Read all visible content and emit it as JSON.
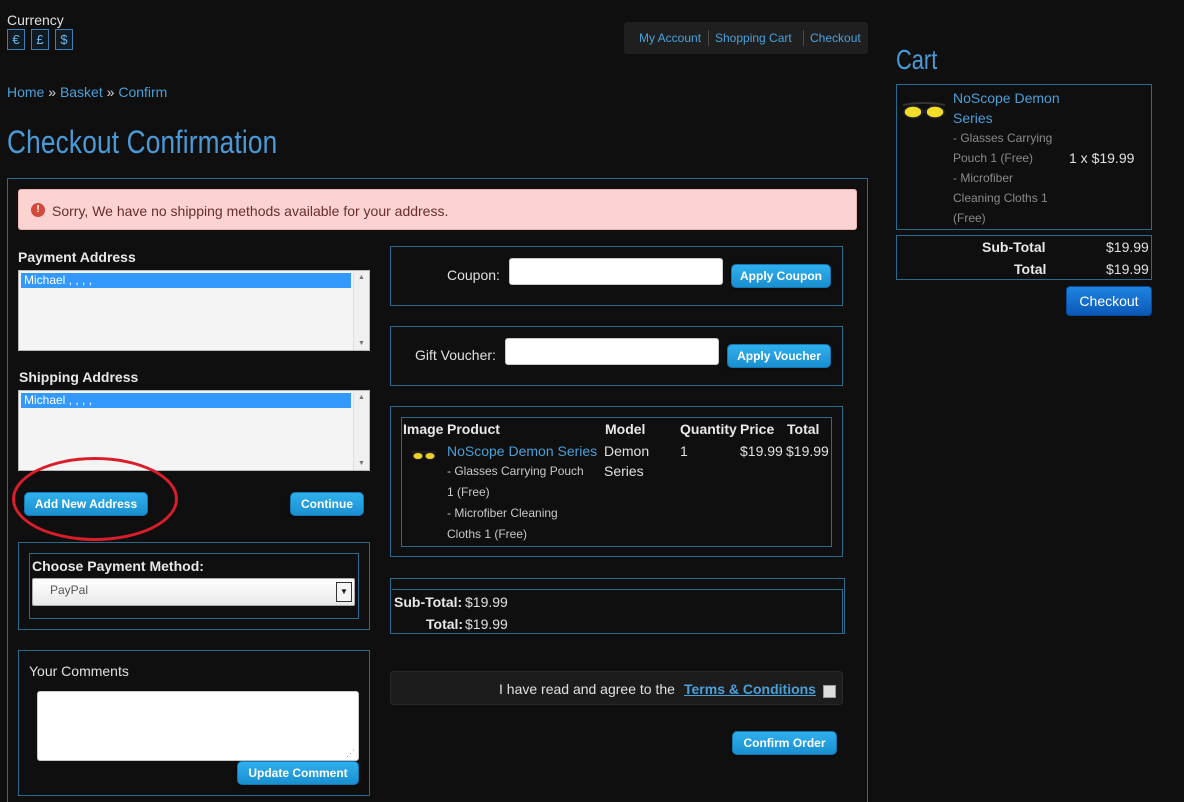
{
  "currency": {
    "label": "Currency",
    "symbols": [
      "€",
      "£",
      "$"
    ]
  },
  "top_nav": {
    "items": [
      "My Account",
      "Shopping Cart",
      "Checkout"
    ]
  },
  "breadcrumb": {
    "items": [
      "Home",
      "Basket",
      "Confirm"
    ],
    "separator": "»"
  },
  "page": {
    "title": "Checkout Confirmation"
  },
  "alert": {
    "icon": "!",
    "message": "Sorry, We have no shipping methods available for your address."
  },
  "payment_address": {
    "label": "Payment Address",
    "selected": "Michael , , , ,"
  },
  "shipping_address": {
    "label": "Shipping Address",
    "selected": "Michael , , , ,"
  },
  "buttons": {
    "add_new_address": "Add New Address",
    "continue": "Continue",
    "apply_coupon": "Apply Coupon",
    "apply_voucher": "Apply Voucher",
    "update_comment": "Update Comment",
    "confirm_order": "Confirm Order"
  },
  "payment_method": {
    "label": "Choose Payment Method:",
    "selected": "PayPal"
  },
  "comments": {
    "label": "Your Comments",
    "value": ""
  },
  "coupon": {
    "label": "Coupon:",
    "value": ""
  },
  "voucher": {
    "label": "Gift Voucher:",
    "value": ""
  },
  "order_table": {
    "headers": [
      "Image",
      "Product",
      "Model",
      "Quantity",
      "Price",
      "Total"
    ],
    "row": {
      "product": "NoScope Demon Series",
      "options": [
        "- Glasses Carrying Pouch",
        "1 (Free)",
        "- Microfiber Cleaning",
        "Cloths 1 (Free)"
      ],
      "model_line1": "Demon",
      "model_line2": "Series",
      "quantity": "1",
      "price": "$19.99",
      "total": "$19.99"
    }
  },
  "order_totals": {
    "subtotal_label": "Sub-Total:",
    "subtotal": "$19.99",
    "total_label": "Total:",
    "total": "$19.99"
  },
  "terms": {
    "text": "I have read and agree to the",
    "link": "Terms & Conditions"
  },
  "cart": {
    "title": "Cart",
    "product_line1": "NoScope Demon",
    "product_line2": "Series",
    "options": [
      "- Glasses Carrying",
      "Pouch 1 (Free)",
      "- Microfiber",
      "Cleaning Cloths 1",
      "(Free)"
    ],
    "qty_price": "1 x $19.99",
    "subtotal_label": "Sub-Total",
    "subtotal": "$19.99",
    "total_label": "Total",
    "total": "$19.99",
    "checkout": "Checkout"
  },
  "colors": {
    "accent": "#4a9ad8",
    "button": "#1a9be0",
    "alert_bg": "#fbd3d3",
    "annotation_circle": "#d81e2a"
  }
}
